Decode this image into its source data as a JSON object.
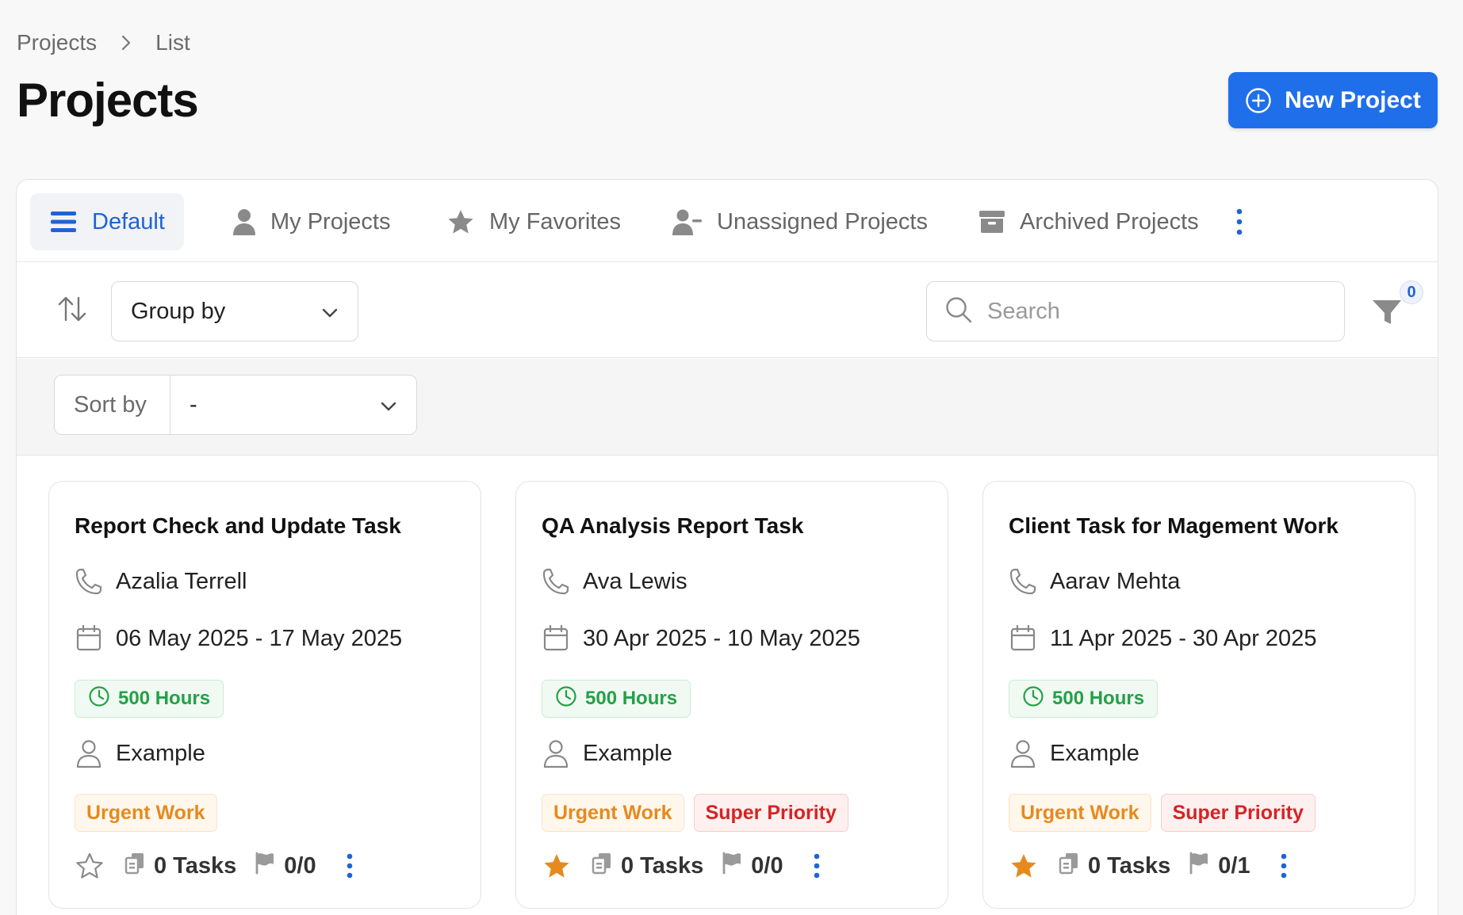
{
  "breadcrumb": {
    "root": "Projects",
    "current": "List"
  },
  "page": {
    "title": "Projects",
    "new_button": "New Project"
  },
  "tabs": [
    {
      "label": "Default",
      "icon": "list-icon",
      "active": true
    },
    {
      "label": "My Projects",
      "icon": "user-icon",
      "active": false
    },
    {
      "label": "My Favorites",
      "icon": "star-icon",
      "active": false
    },
    {
      "label": "Unassigned Projects",
      "icon": "user-minus-icon",
      "active": false
    },
    {
      "label": "Archived Projects",
      "icon": "archive-icon",
      "active": false
    }
  ],
  "toolbar": {
    "group_by": "Group by",
    "search_placeholder": "Search",
    "filter_count": "0"
  },
  "sortbar": {
    "label": "Sort by",
    "value": "-"
  },
  "colors": {
    "accent": "#1f6feb",
    "hours": "#25a047",
    "urgent": "#e58a1f",
    "priority": "#d42424",
    "favorite": "#e58a1f"
  },
  "cards": [
    {
      "title": "Report Check and Update Task",
      "contact": "Azalia Terrell",
      "dates": "06 May 2025 - 17 May 2025",
      "hours": "500 Hours",
      "owner": "Example",
      "tags": [
        "Urgent Work"
      ],
      "favorite": false,
      "tasks": "0 Tasks",
      "milestones": "0/0"
    },
    {
      "title": "QA Analysis Report Task",
      "contact": "Ava Lewis",
      "dates": "30 Apr 2025 - 10 May 2025",
      "hours": "500 Hours",
      "owner": "Example",
      "tags": [
        "Urgent Work",
        "Super Priority"
      ],
      "favorite": true,
      "tasks": "0 Tasks",
      "milestones": "0/0"
    },
    {
      "title": "Client Task for Magement Work",
      "contact": "Aarav Mehta",
      "dates": "11 Apr 2025 - 30 Apr 2025",
      "hours": "500 Hours",
      "owner": "Example",
      "tags": [
        "Urgent Work",
        "Super Priority"
      ],
      "favorite": true,
      "tasks": "0 Tasks",
      "milestones": "0/1"
    }
  ]
}
